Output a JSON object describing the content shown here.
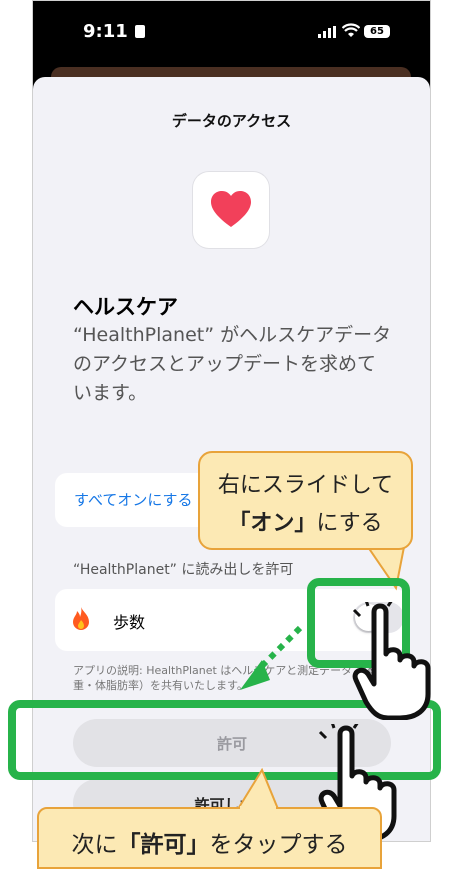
{
  "status_bar": {
    "time": "9:11",
    "battery": "65"
  },
  "sheet": {
    "title": "データのアクセス",
    "heading": "ヘルスケア",
    "description": "“HealthPlanet” がヘルスケアデータのアクセスとアップデートを求めています。",
    "turn_all_on": "すべてオンにする",
    "read_section_header": "“HealthPlanet” に読み出しを許可",
    "steps_label": "歩数",
    "steps_toggle_on": false,
    "app_explanation": "アプリの説明: HealthPlanet はヘルスケアと測定データ（体重・体脂肪率）を共有いたします。",
    "allow_button": "許可",
    "deny_button": "許可しない"
  },
  "annotations": {
    "callout_toggle_line1": "右にスライドして",
    "callout_toggle_bold": "「オン」",
    "callout_toggle_rest": "にする",
    "callout_allow_pre": "次に",
    "callout_allow_bold": "「許可」",
    "callout_allow_post": "をタップする"
  },
  "colors": {
    "highlight_green": "#27b34a",
    "callout_fill": "#fce9b4",
    "callout_border": "#e8a33a",
    "link_blue": "#1677e6",
    "heart_red": "#f2405a"
  }
}
